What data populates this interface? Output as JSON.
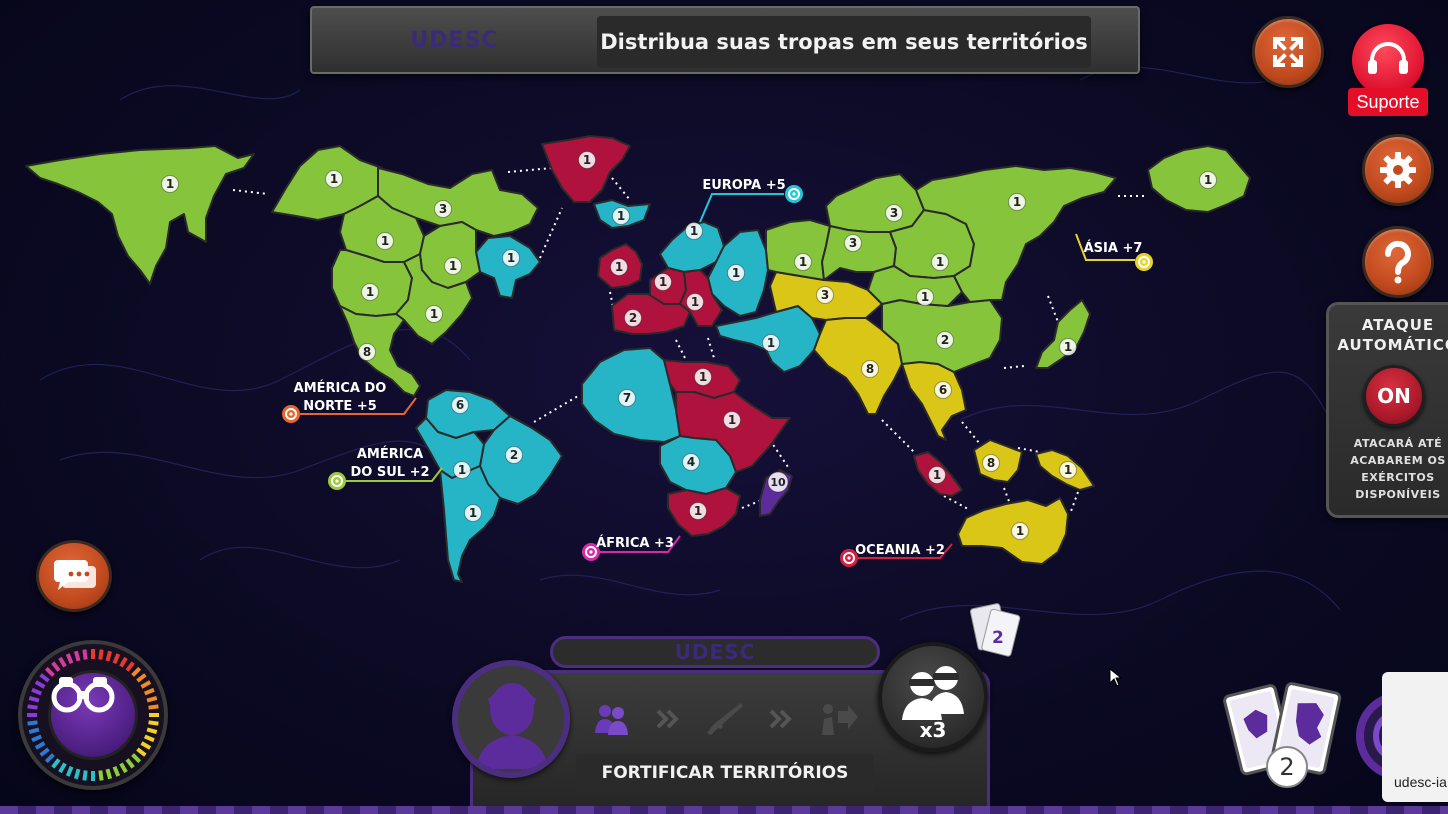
{
  "banner": {
    "player": "UDESC",
    "message": "Distribua suas tropas em seus territórios"
  },
  "support": {
    "label": "Suporte"
  },
  "auto_attack": {
    "title": "ATAQUE AUTOMÁTICO",
    "state": "ON",
    "description": "ATACARÁ ATÉ ACABAREM OS EXÉRCITOS DISPONÍVEIS"
  },
  "continents": [
    {
      "label": "AMÉRICA DO NORTE +5",
      "color": "#e8662e"
    },
    {
      "label": "AMÉRICA DO SUL +2",
      "color": "#9ccb3a"
    },
    {
      "label": "EUROPA +5",
      "color": "#22c6d6"
    },
    {
      "label": "ÁFRICA +3",
      "color": "#d62aa8"
    },
    {
      "label": "ÁSIA +7",
      "color": "#e6d42a"
    },
    {
      "label": "OCEANIA +2",
      "color": "#d6203e"
    }
  ],
  "player_colors": {
    "green": "#86c43c",
    "cyan": "#25b5c7",
    "red": "#b0123e",
    "yellow": "#d9c616",
    "purple": "#5c2c9c"
  },
  "territories": [
    {
      "name": "alaska",
      "owner": "green",
      "troops": "1"
    },
    {
      "name": "mackenzie",
      "owner": "green",
      "troops": "1"
    },
    {
      "name": "groenlandia",
      "owner": "red",
      "troops": "1"
    },
    {
      "name": "vancouver",
      "owner": "green",
      "troops": "3"
    },
    {
      "name": "ottawa",
      "owner": "green",
      "troops": "1"
    },
    {
      "name": "labrador",
      "owner": "cyan",
      "troops": "1"
    },
    {
      "name": "ottawa-sul",
      "owner": "green",
      "troops": "1"
    },
    {
      "name": "california",
      "owner": "green",
      "troops": "1"
    },
    {
      "name": "nova-york",
      "owner": "green",
      "troops": "1"
    },
    {
      "name": "mexico",
      "owner": "green",
      "troops": "8"
    },
    {
      "name": "colombia",
      "owner": "cyan",
      "troops": "6"
    },
    {
      "name": "brasil",
      "owner": "cyan",
      "troops": "2"
    },
    {
      "name": "peru",
      "owner": "cyan",
      "troops": "1"
    },
    {
      "name": "argentina",
      "owner": "cyan",
      "troops": "1"
    },
    {
      "name": "islandia",
      "owner": "cyan",
      "troops": "1"
    },
    {
      "name": "inglaterra",
      "owner": "red",
      "troops": "1"
    },
    {
      "name": "suecia",
      "owner": "cyan",
      "troops": "1"
    },
    {
      "name": "moscou",
      "owner": "cyan",
      "troops": "1"
    },
    {
      "name": "alemanha",
      "owner": "red",
      "troops": "1"
    },
    {
      "name": "polonia",
      "owner": "red",
      "troops": "1"
    },
    {
      "name": "portugal",
      "owner": "red",
      "troops": "2"
    },
    {
      "name": "argelia",
      "owner": "cyan",
      "troops": "7"
    },
    {
      "name": "egito",
      "owner": "red",
      "troops": "1"
    },
    {
      "name": "sudao",
      "owner": "red",
      "troops": "1"
    },
    {
      "name": "congo",
      "owner": "cyan",
      "troops": "4"
    },
    {
      "name": "africa-do-sul",
      "owner": "red",
      "troops": "1"
    },
    {
      "name": "madagascar",
      "owner": "purple",
      "troops": "10"
    },
    {
      "name": "oriente-medio",
      "owner": "cyan",
      "troops": "1"
    },
    {
      "name": "aral",
      "owner": "yellow",
      "troops": "3"
    },
    {
      "name": "india",
      "owner": "yellow",
      "troops": "8"
    },
    {
      "name": "vietna",
      "owner": "yellow",
      "troops": "6"
    },
    {
      "name": "china",
      "owner": "green",
      "troops": "2"
    },
    {
      "name": "omsk",
      "owner": "green",
      "troops": "1"
    },
    {
      "name": "dudinka",
      "owner": "green",
      "troops": "3"
    },
    {
      "name": "siberia",
      "owner": "green",
      "troops": "3"
    },
    {
      "name": "tchita",
      "owner": "green",
      "troops": "1"
    },
    {
      "name": "mongolia",
      "owner": "green",
      "troops": "1"
    },
    {
      "name": "vladivostok",
      "owner": "green",
      "troops": "1"
    },
    {
      "name": "kamchatka",
      "owner": "green",
      "troops": "1"
    },
    {
      "name": "japao",
      "owner": "green",
      "troops": "1"
    },
    {
      "name": "sumatra",
      "owner": "red",
      "troops": "1"
    },
    {
      "name": "borneo",
      "owner": "yellow",
      "troops": "8"
    },
    {
      "name": "nova-guine",
      "owner": "yellow",
      "troops": "1"
    },
    {
      "name": "australia",
      "owner": "yellow",
      "troops": "1"
    }
  ],
  "console": {
    "player_name": "UDESC",
    "phase_label": "FORTIFICAR TERRITÓRIOS",
    "troops_available": "x3"
  },
  "cards": {
    "mini_count": "2",
    "hand_count": "2"
  },
  "tooltip": {
    "text": "udesc-ia"
  },
  "icons": {
    "fullscreen": "fullscreen-icon",
    "support": "headset-icon",
    "settings": "gear-icon",
    "help": "question-icon",
    "chat": "chat-icon",
    "spy": "binoculars-icon",
    "troops": "soldiers-icon",
    "phase_distribute": "troops-icon",
    "phase_attack": "rifle-icon",
    "phase_move": "move-icon"
  }
}
